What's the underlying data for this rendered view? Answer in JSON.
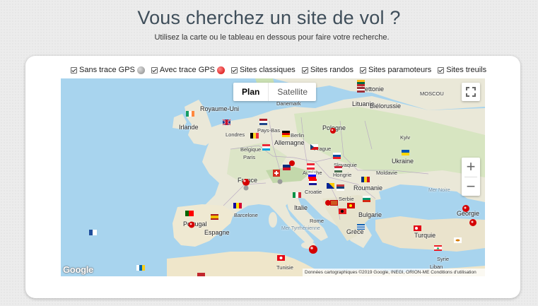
{
  "header": {
    "title": "Vous cherchez un site de vol ?",
    "subtitle": "Utilisez la carte ou le tableau en dessous pour faire votre recherche."
  },
  "filters": [
    {
      "label": "Sans trace GPS",
      "checked": true,
      "icon": "grey-pin-icon"
    },
    {
      "label": "Avec trace GPS",
      "checked": true,
      "icon": "red-pin-icon"
    },
    {
      "label": "Sites classiques",
      "checked": true
    },
    {
      "label": "Sites randos",
      "checked": true
    },
    {
      "label": "Sites paramoteurs",
      "checked": true
    },
    {
      "label": "Sites treuils",
      "checked": true
    }
  ],
  "map": {
    "type_control": {
      "plan": "Plan",
      "satellite": "Satellite",
      "selected": "Plan"
    },
    "zoom_in": "+",
    "zoom_out": "−",
    "logo": "Google",
    "attribution": "Données cartographiques ©2019 Google, INEGI, ORION-ME  Conditions d'utilisation",
    "labels": {
      "lettonie": "Lettonie",
      "moscou": "MOSCOU",
      "danemark": "Danemark",
      "royaume_uni": "Royaume-Uni",
      "lituanie": "Lituanie",
      "irlande": "Irlande",
      "bielorussie": "Biélorussie",
      "londres": "Londres",
      "pays_bas": "Pays-Bas",
      "berlin": "Berlin",
      "pologne": "Pologne",
      "kyiv": "Kyiv",
      "belgique": "Belgique",
      "allemagne": "Allemagne",
      "paris": "Paris",
      "prague": "Prague",
      "slovaquie": "Slovaquie",
      "ukraine": "Ukraine",
      "autriche": "Autriche",
      "hongrie": "Hongrie",
      "moldavie": "Moldavie",
      "france": "France",
      "croatie": "Croatie",
      "roumanie": "Roumanie",
      "serbie": "Serbie",
      "italie": "Italie",
      "mer_noire": "Mer Noire",
      "rome": "Rome",
      "barcelone": "Barcelone",
      "bulgarie": "Bulgarie",
      "georgie": "Géorgie",
      "portugal": "Portugal",
      "espagne": "Espagne",
      "grece": "Grèce",
      "turquie": "Turquie",
      "mer_tyrrhenienne": "Mer Tyrrhénienne",
      "tunisie": "Tunisie",
      "syrie": "Syrie",
      "liban": "Liban"
    },
    "colors": {
      "water": "#a8d4ee",
      "land": "#eae8d8",
      "forest": "#c9dfb2",
      "marker_red": "#d40000",
      "marker_grey": "#9a9a9a"
    }
  }
}
